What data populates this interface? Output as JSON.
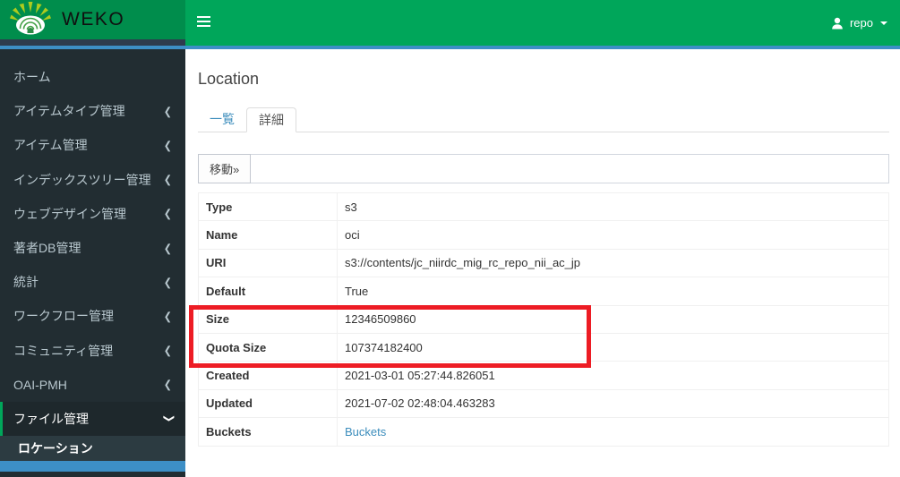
{
  "header": {
    "logo_text": "WEKO",
    "user_name": "repo"
  },
  "icons": {
    "chevron_left": "❮",
    "chevron_down": "❮"
  },
  "sidebar": {
    "items": [
      {
        "label": "ホーム"
      },
      {
        "label": "アイテムタイプ管理"
      },
      {
        "label": "アイテム管理"
      },
      {
        "label": "インデックスツリー管理"
      },
      {
        "label": "ウェブデザイン管理"
      },
      {
        "label": "著者DB管理"
      },
      {
        "label": "統計"
      },
      {
        "label": "ワークフロー管理"
      },
      {
        "label": "コミュニティ管理"
      },
      {
        "label": "OAI-PMH"
      },
      {
        "label": "ファイル管理"
      }
    ],
    "submenu": [
      {
        "label": "ロケーション"
      }
    ]
  },
  "main": {
    "title": "Location",
    "tabs": [
      {
        "label": "一覧"
      },
      {
        "label": "詳細"
      }
    ],
    "toolbar": {
      "move_label": "移動»"
    },
    "details": {
      "rows": [
        {
          "label": "Type",
          "value": "s3"
        },
        {
          "label": "Name",
          "value": "oci"
        },
        {
          "label": "URI",
          "value": "s3://contents/jc_niirdc_mig_rc_repo_nii_ac_jp"
        },
        {
          "label": "Default",
          "value": "True"
        },
        {
          "label": "Size",
          "value": "12346509860"
        },
        {
          "label": "Quota Size",
          "value": "107374182400"
        },
        {
          "label": "Created",
          "value": "2021-03-01 05:27:44.826051"
        },
        {
          "label": "Updated",
          "value": "2021-07-02 02:48:04.463283"
        },
        {
          "label": "Buckets",
          "value": "Buckets"
        }
      ]
    }
  },
  "colors": {
    "navbar_green": "#00a65a",
    "logo_green": "#008d4c",
    "sidebar_dark": "#222d32",
    "accent_blue": "#3d8fc6",
    "highlight_red": "#ed1c24"
  }
}
